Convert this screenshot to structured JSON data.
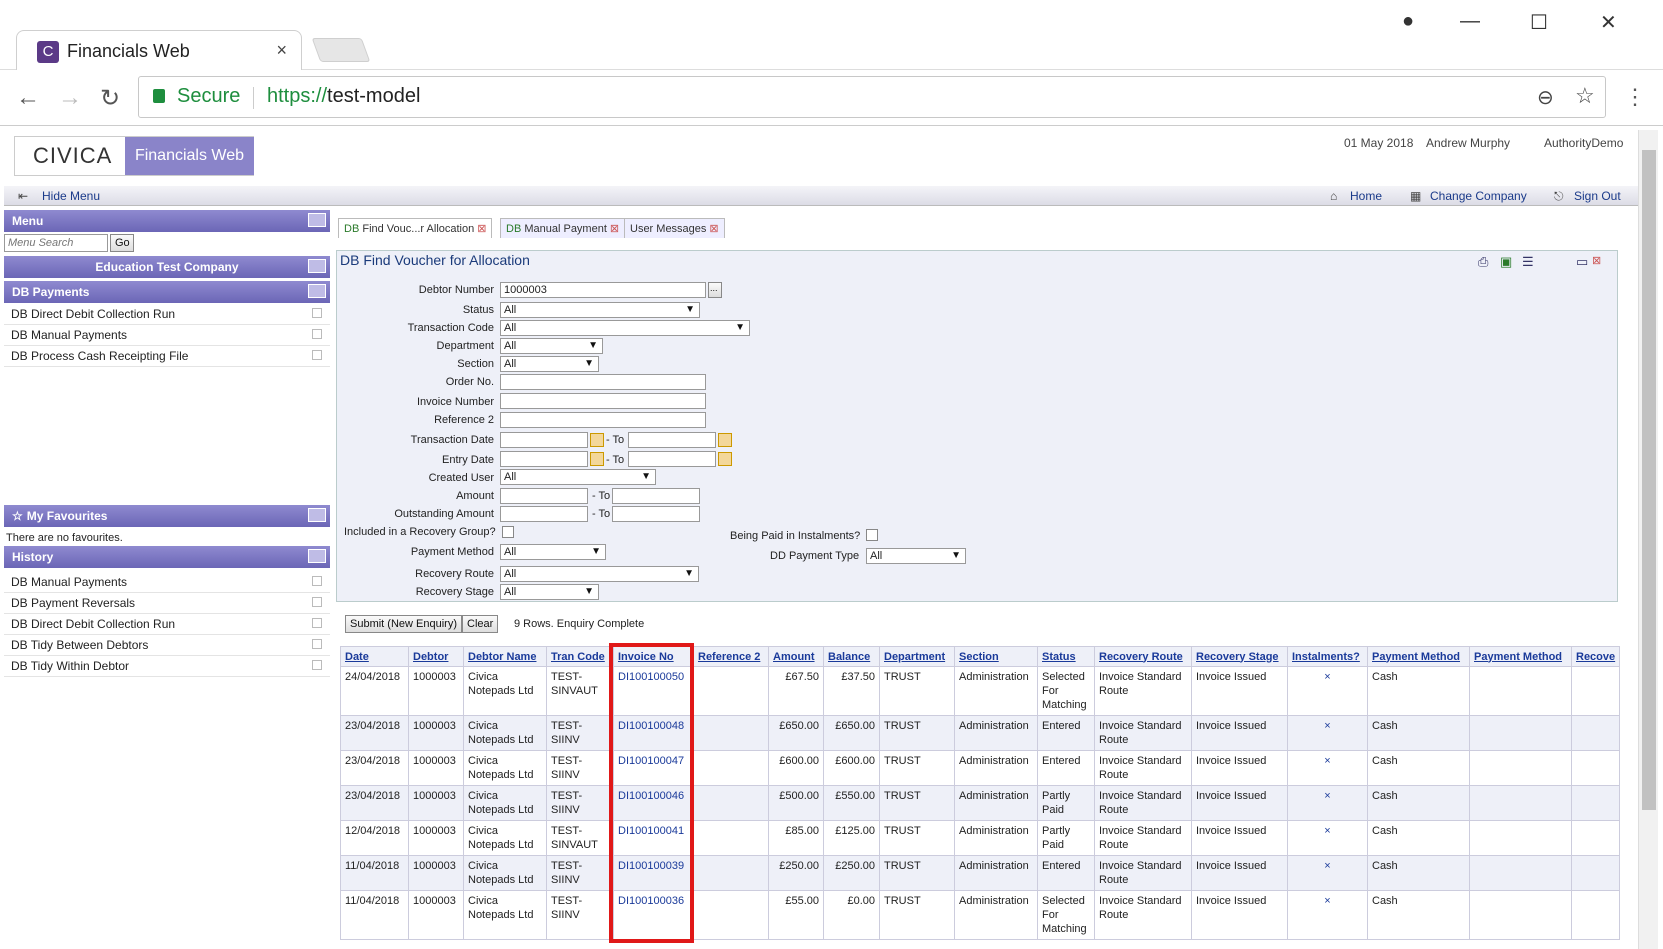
{
  "browser": {
    "tab_title": "Financials Web",
    "tab_close": "×",
    "secure_label": "Secure",
    "url_scheme": "https://",
    "url_host": "test-model"
  },
  "app": {
    "logo_text": "CIVICA",
    "logo_product": "Financials Web",
    "date": "01 May 2018",
    "user": "Andrew Murphy",
    "authority": "AuthorityDemo",
    "hide_menu": "Hide Menu",
    "home": "Home",
    "change_company": "Change Company",
    "sign_out": "Sign Out"
  },
  "sidebar": {
    "menu_title": "Menu",
    "menu_search_placeholder": "Menu Search",
    "go": "Go",
    "company": "Education Test Company",
    "section_title": "DB Payments",
    "items": [
      "DB Direct Debit Collection Run",
      "DB Manual Payments",
      "DB Process Cash Receipting File"
    ],
    "favourites_title": "My Favourites",
    "favourites_empty": "There are no favourites.",
    "history_title": "History",
    "history": [
      "DB Manual Payments",
      "DB Payment Reversals",
      "DB Direct Debit Collection Run",
      "DB Tidy Between Debtors",
      "DB Tidy Within Debtor"
    ]
  },
  "tabs": [
    {
      "prefix": "DB",
      "label": "Find Vouc...r Allocation"
    },
    {
      "prefix": "DB",
      "label": "Manual Payment"
    },
    {
      "prefix": "",
      "label": "User Messages"
    }
  ],
  "form": {
    "title": "DB Find Voucher for Allocation",
    "debtor_number_label": "Debtor Number",
    "debtor_number": "1000003",
    "status_label": "Status",
    "transaction_code_label": "Transaction Code",
    "department_label": "Department",
    "section_label": "Section",
    "order_no_label": "Order No.",
    "invoice_number_label": "Invoice Number",
    "reference2_label": "Reference 2",
    "transaction_date_label": "Transaction Date",
    "entry_date_label": "Entry Date",
    "created_user_label": "Created User",
    "amount_label": "Amount",
    "outstanding_amount_label": "Outstanding Amount",
    "recovery_group_label": "Included in a Recovery Group?",
    "instalments_label": "Being Paid in Instalments?",
    "payment_method_label": "Payment Method",
    "dd_payment_type_label": "DD Payment Type",
    "recovery_route_label": "Recovery Route",
    "recovery_stage_label": "Recovery Stage",
    "all": "All",
    "to": "- To",
    "ellipsis": "...",
    "submit": "Submit (New Enquiry)",
    "clear": "Clear",
    "status_msg": "9 Rows. Enquiry Complete"
  },
  "table": {
    "headers": [
      "Date",
      "Debtor",
      "Debtor Name",
      "Tran Code",
      "Invoice No",
      "Reference 2",
      "Amount",
      "Balance",
      "Department",
      "Section",
      "Status",
      "Recovery Route",
      "Recovery Stage",
      "Instalments?",
      "Payment Method",
      "Payment Method",
      "Recove"
    ],
    "rows": [
      [
        "24/04/2018",
        "1000003",
        "Civica Notepads Ltd",
        "TEST-SINVAUT",
        "DI100100050",
        "",
        "£67.50",
        "£37.50",
        "TRUST",
        "Administration",
        "Selected For Matching",
        "Invoice Standard Route",
        "Invoice Issued",
        "×",
        "Cash",
        "",
        ""
      ],
      [
        "23/04/2018",
        "1000003",
        "Civica Notepads Ltd",
        "TEST-SIINV",
        "DI100100048",
        "",
        "£650.00",
        "£650.00",
        "TRUST",
        "Administration",
        "Entered",
        "Invoice Standard Route",
        "Invoice Issued",
        "×",
        "Cash",
        "",
        ""
      ],
      [
        "23/04/2018",
        "1000003",
        "Civica Notepads Ltd",
        "TEST-SIINV",
        "DI100100047",
        "",
        "£600.00",
        "£600.00",
        "TRUST",
        "Administration",
        "Entered",
        "Invoice Standard Route",
        "Invoice Issued",
        "×",
        "Cash",
        "",
        ""
      ],
      [
        "23/04/2018",
        "1000003",
        "Civica Notepads Ltd",
        "TEST-SIINV",
        "DI100100046",
        "",
        "£500.00",
        "£550.00",
        "TRUST",
        "Administration",
        "Partly Paid",
        "Invoice Standard Route",
        "Invoice Issued",
        "×",
        "Cash",
        "",
        ""
      ],
      [
        "12/04/2018",
        "1000003",
        "Civica Notepads Ltd",
        "TEST-SINVAUT",
        "DI100100041",
        "",
        "£85.00",
        "£125.00",
        "TRUST",
        "Administration",
        "Partly Paid",
        "Invoice Standard Route",
        "Invoice Issued",
        "×",
        "Cash",
        "",
        ""
      ],
      [
        "11/04/2018",
        "1000003",
        "Civica Notepads Ltd",
        "TEST-SIINV",
        "DI100100039",
        "",
        "£250.00",
        "£250.00",
        "TRUST",
        "Administration",
        "Entered",
        "Invoice Standard Route",
        "Invoice Issued",
        "×",
        "Cash",
        "",
        ""
      ],
      [
        "11/04/2018",
        "1000003",
        "Civica Notepads Ltd",
        "TEST-SIINV",
        "DI100100036",
        "",
        "£55.00",
        "£0.00",
        "TRUST",
        "Administration",
        "Selected For Matching",
        "Invoice Standard Route",
        "Invoice Issued",
        "×",
        "Cash",
        "",
        ""
      ]
    ]
  },
  "colors": {
    "accent": "#6b66b6",
    "link": "#1a3a9a",
    "highlight": "#e01818",
    "secure": "#1e8e3e"
  }
}
